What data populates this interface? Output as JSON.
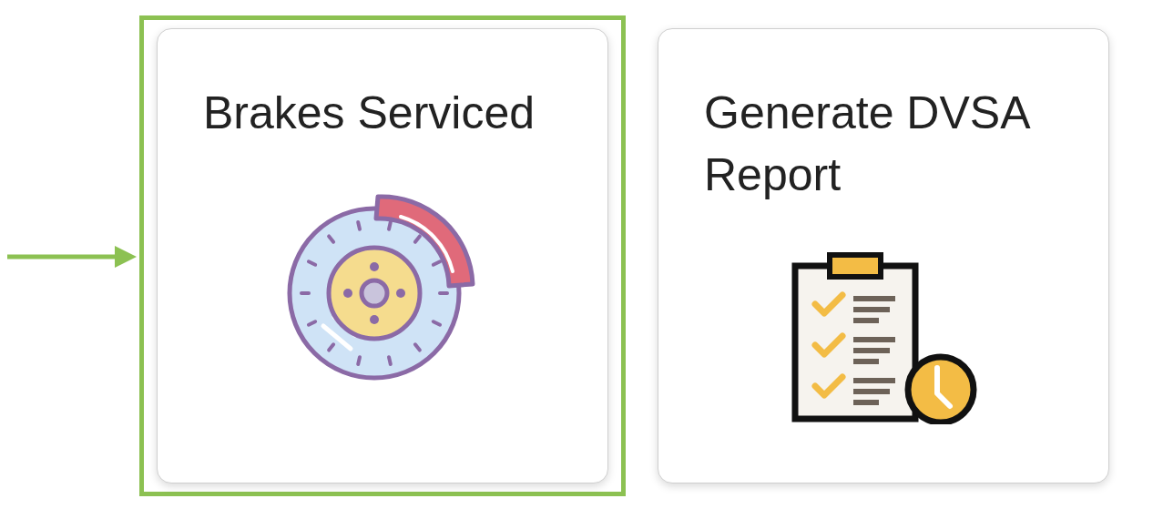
{
  "cards": [
    {
      "title": "Brakes Serviced",
      "kind": "brake",
      "selected": true
    },
    {
      "title": "Generate DVSA Report",
      "kind": "report",
      "selected": false
    }
  ]
}
